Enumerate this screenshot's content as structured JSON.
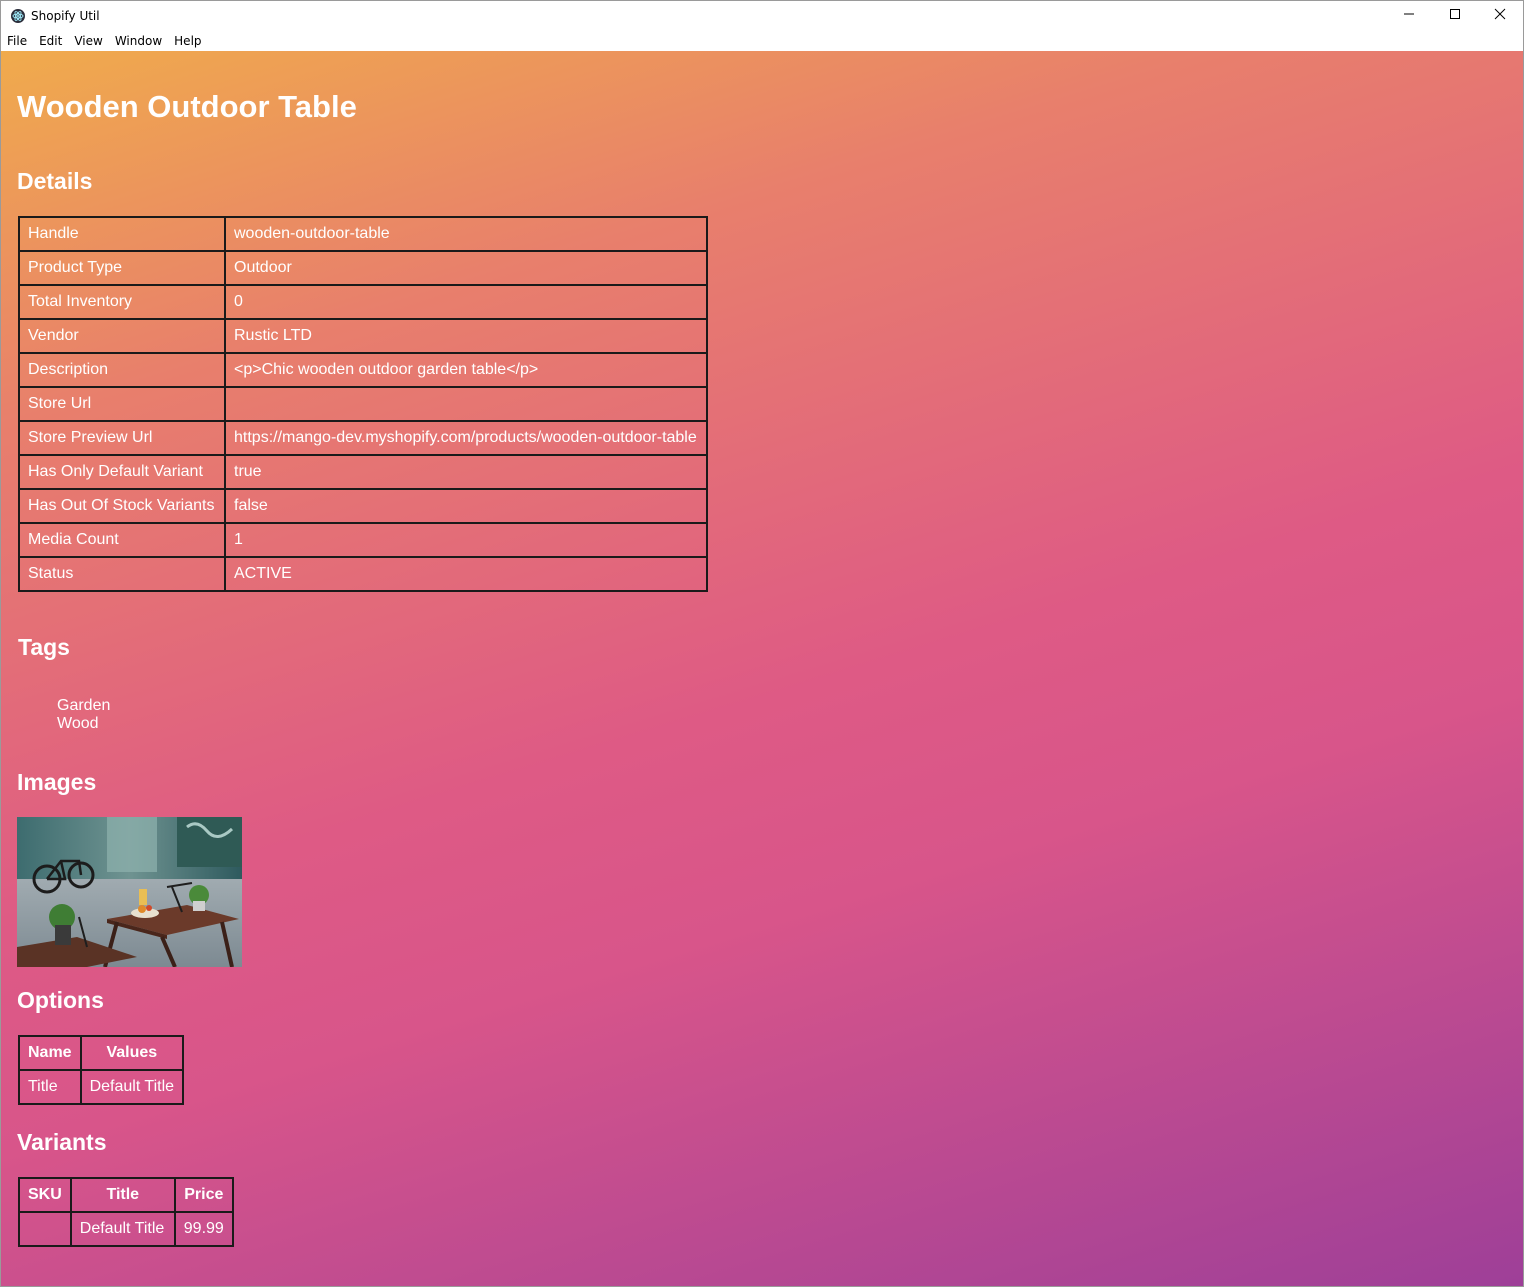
{
  "window": {
    "title": "Shopify Util",
    "icon": "electron-atom-icon"
  },
  "menu": [
    "File",
    "Edit",
    "View",
    "Window",
    "Help"
  ],
  "product": {
    "title": "Wooden Outdoor Table"
  },
  "sections": {
    "details": "Details",
    "tags": "Tags",
    "images": "Images",
    "options": "Options",
    "variants": "Variants"
  },
  "details": [
    {
      "key": "Handle",
      "value": "wooden-outdoor-table"
    },
    {
      "key": "Product Type",
      "value": "Outdoor"
    },
    {
      "key": "Total Inventory",
      "value": "0"
    },
    {
      "key": "Vendor",
      "value": "Rustic LTD"
    },
    {
      "key": "Description",
      "value": "<p>Chic wooden outdoor garden table</p>"
    },
    {
      "key": "Store Url",
      "value": ""
    },
    {
      "key": "Store Preview Url",
      "value": "https://mango-dev.myshopify.com/products/wooden-outdoor-table"
    },
    {
      "key": "Has Only Default Variant",
      "value": "true"
    },
    {
      "key": "Has Out Of Stock Variants",
      "value": "false"
    },
    {
      "key": "Media Count",
      "value": "1"
    },
    {
      "key": "Status",
      "value": "ACTIVE"
    }
  ],
  "tags": [
    "Garden",
    "Wood"
  ],
  "options": {
    "headers": [
      "Name",
      "Values"
    ],
    "rows": [
      [
        "Title",
        "Default Title"
      ]
    ]
  },
  "variants": {
    "headers": [
      "SKU",
      "Title",
      "Price"
    ],
    "rows": [
      [
        "",
        "Default Title",
        "99.99"
      ]
    ]
  },
  "colors": {
    "gradient_top": "#f0ab4c",
    "gradient_mid": "#de5a85",
    "gradient_bottom": "#9e3f98",
    "table_border": "#1a1a1a"
  }
}
